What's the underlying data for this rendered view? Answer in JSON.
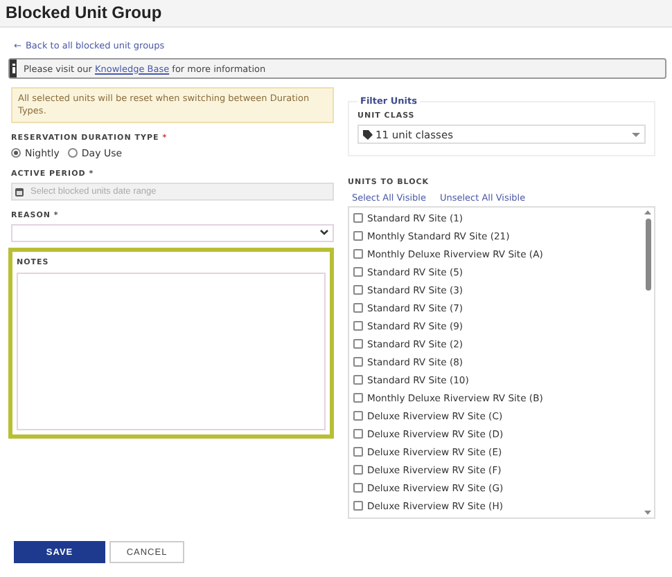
{
  "header": {
    "title": "Blocked Unit Group"
  },
  "back_link": {
    "arrow": "←",
    "label": "Back to all blocked unit groups"
  },
  "info_bar": {
    "text": "Please visit our",
    "link": "Knowledge Base",
    "after": "for more information"
  },
  "warning": "All selected units will be reset when switching between Duration Types.",
  "duration": {
    "label": "RESERVATION DURATION TYPE",
    "required": "*",
    "options": [
      {
        "label": "Nightly",
        "selected": true
      },
      {
        "label": "Day Use",
        "selected": false
      }
    ]
  },
  "active_period": {
    "label": "ACTIVE PERIOD *",
    "placeholder": "Select blocked units date range"
  },
  "reason": {
    "label": "REASON *"
  },
  "notes": {
    "label": "NOTES",
    "highlighted": true
  },
  "filter": {
    "legend": "Filter Units",
    "unit_class_label": "UNIT CLASS",
    "unit_class_value": "11 unit classes"
  },
  "units": {
    "label": "UNITS TO BLOCK",
    "select_all": "Select All Visible",
    "unselect_all": "Unselect All Visible",
    "items": [
      {
        "label": "Standard RV Site (1)",
        "checked": false
      },
      {
        "label": "Monthly Standard RV Site (21)",
        "checked": false
      },
      {
        "label": "Monthly Deluxe Riverview RV Site (A)",
        "checked": false
      },
      {
        "label": "Standard RV Site (5)",
        "checked": false
      },
      {
        "label": "Standard RV Site (3)",
        "checked": false
      },
      {
        "label": "Standard RV Site (7)",
        "checked": false
      },
      {
        "label": "Standard RV Site (9)",
        "checked": false
      },
      {
        "label": "Standard RV Site (2)",
        "checked": false
      },
      {
        "label": "Standard RV Site (8)",
        "checked": false
      },
      {
        "label": "Standard RV Site (10)",
        "checked": false
      },
      {
        "label": "Monthly Deluxe Riverview RV Site (B)",
        "checked": false
      },
      {
        "label": "Deluxe Riverview RV Site (C)",
        "checked": false
      },
      {
        "label": "Deluxe Riverview RV Site (D)",
        "checked": false
      },
      {
        "label": "Deluxe Riverview RV Site (E)",
        "checked": false
      },
      {
        "label": "Deluxe Riverview RV Site (F)",
        "checked": false
      },
      {
        "label": "Deluxe Riverview RV Site (G)",
        "checked": false
      },
      {
        "label": "Deluxe Riverview RV Site (H)",
        "checked": false
      }
    ]
  },
  "buttons": {
    "save": "SAVE",
    "cancel": "CANCEL"
  }
}
